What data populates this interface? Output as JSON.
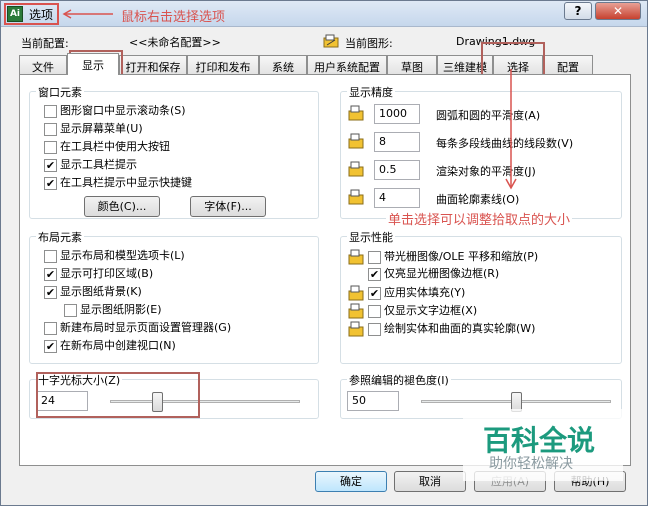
{
  "window": {
    "title": "选项",
    "icon_label": "Ai",
    "help_glyph": "?",
    "close_glyph": "✕"
  },
  "annotations": {
    "right_click": "鼠标右击选择选项",
    "click_select": "单击选择可以调整拾取点的大小",
    "accent_color": "#d9534f"
  },
  "header": {
    "profile_label": "当前配置:",
    "profile_value": "<<未命名配置>>",
    "drawing_label": "当前图形:",
    "drawing_value": "Drawing1.dwg"
  },
  "tabs": [
    {
      "label": "文件",
      "active": false
    },
    {
      "label": "显示",
      "active": true
    },
    {
      "label": "打开和保存",
      "active": false
    },
    {
      "label": "打印和发布",
      "active": false
    },
    {
      "label": "系统",
      "active": false
    },
    {
      "label": "用户系统配置",
      "active": false
    },
    {
      "label": "草图",
      "active": false
    },
    {
      "label": "三维建模",
      "active": false
    },
    {
      "label": "选择",
      "active": false
    },
    {
      "label": "配置",
      "active": false
    }
  ],
  "window_elements": {
    "title": "窗口元素",
    "options": [
      {
        "label": "图形窗口中显示滚动条(S)",
        "checked": false
      },
      {
        "label": "显示屏幕菜单(U)",
        "checked": false
      },
      {
        "label": "在工具栏中使用大按钮",
        "checked": false
      },
      {
        "label": "显示工具栏提示",
        "checked": true
      },
      {
        "label": "在工具栏提示中显示快捷键",
        "checked": true
      }
    ],
    "colors_button": "颜色(C)...",
    "fonts_button": "字体(F)..."
  },
  "display_resolution": {
    "title": "显示精度",
    "items": [
      {
        "value": "1000",
        "label": "圆弧和圆的平滑度(A)"
      },
      {
        "value": "8",
        "label": "每条多段线曲线的线段数(V)"
      },
      {
        "value": "0.5",
        "label": "渲染对象的平滑度(J)"
      },
      {
        "value": "4",
        "label": "曲面轮廓素线(O)"
      }
    ]
  },
  "layout_elements": {
    "title": "布局元素",
    "options": [
      {
        "label": "显示布局和模型选项卡(L)",
        "checked": false
      },
      {
        "label": "显示可打印区域(B)",
        "checked": true
      },
      {
        "label": "显示图纸背景(K)",
        "checked": true
      },
      {
        "label": "显示图纸阴影(E)",
        "checked": false
      },
      {
        "label": "新建布局时显示页面设置管理器(G)",
        "checked": false
      },
      {
        "label": "在新布局中创建视口(N)",
        "checked": true
      }
    ]
  },
  "display_performance": {
    "title": "显示性能",
    "options": [
      {
        "label": "带光栅图像/OLE 平移和缩放(P)",
        "checked": false
      },
      {
        "label": "仅亮显光栅图像边框(R)",
        "checked": true
      },
      {
        "label": "应用实体填充(Y)",
        "checked": true
      },
      {
        "label": "仅显示文字边框(X)",
        "checked": false
      },
      {
        "label": "绘制实体和曲面的真实轮廓(W)",
        "checked": false
      }
    ]
  },
  "crosshair": {
    "title": "十字光标大小(Z)",
    "value": "24"
  },
  "xref_fading": {
    "title": "参照编辑的褪色度(I)",
    "value": "50"
  },
  "footer": {
    "ok": "确定",
    "cancel": "取消",
    "apply": "应用(A)",
    "help": "帮助(H)"
  },
  "watermark": {
    "title": "百科全说",
    "subtitle": "助你轻松解决",
    "color": "#1c9a7e"
  }
}
